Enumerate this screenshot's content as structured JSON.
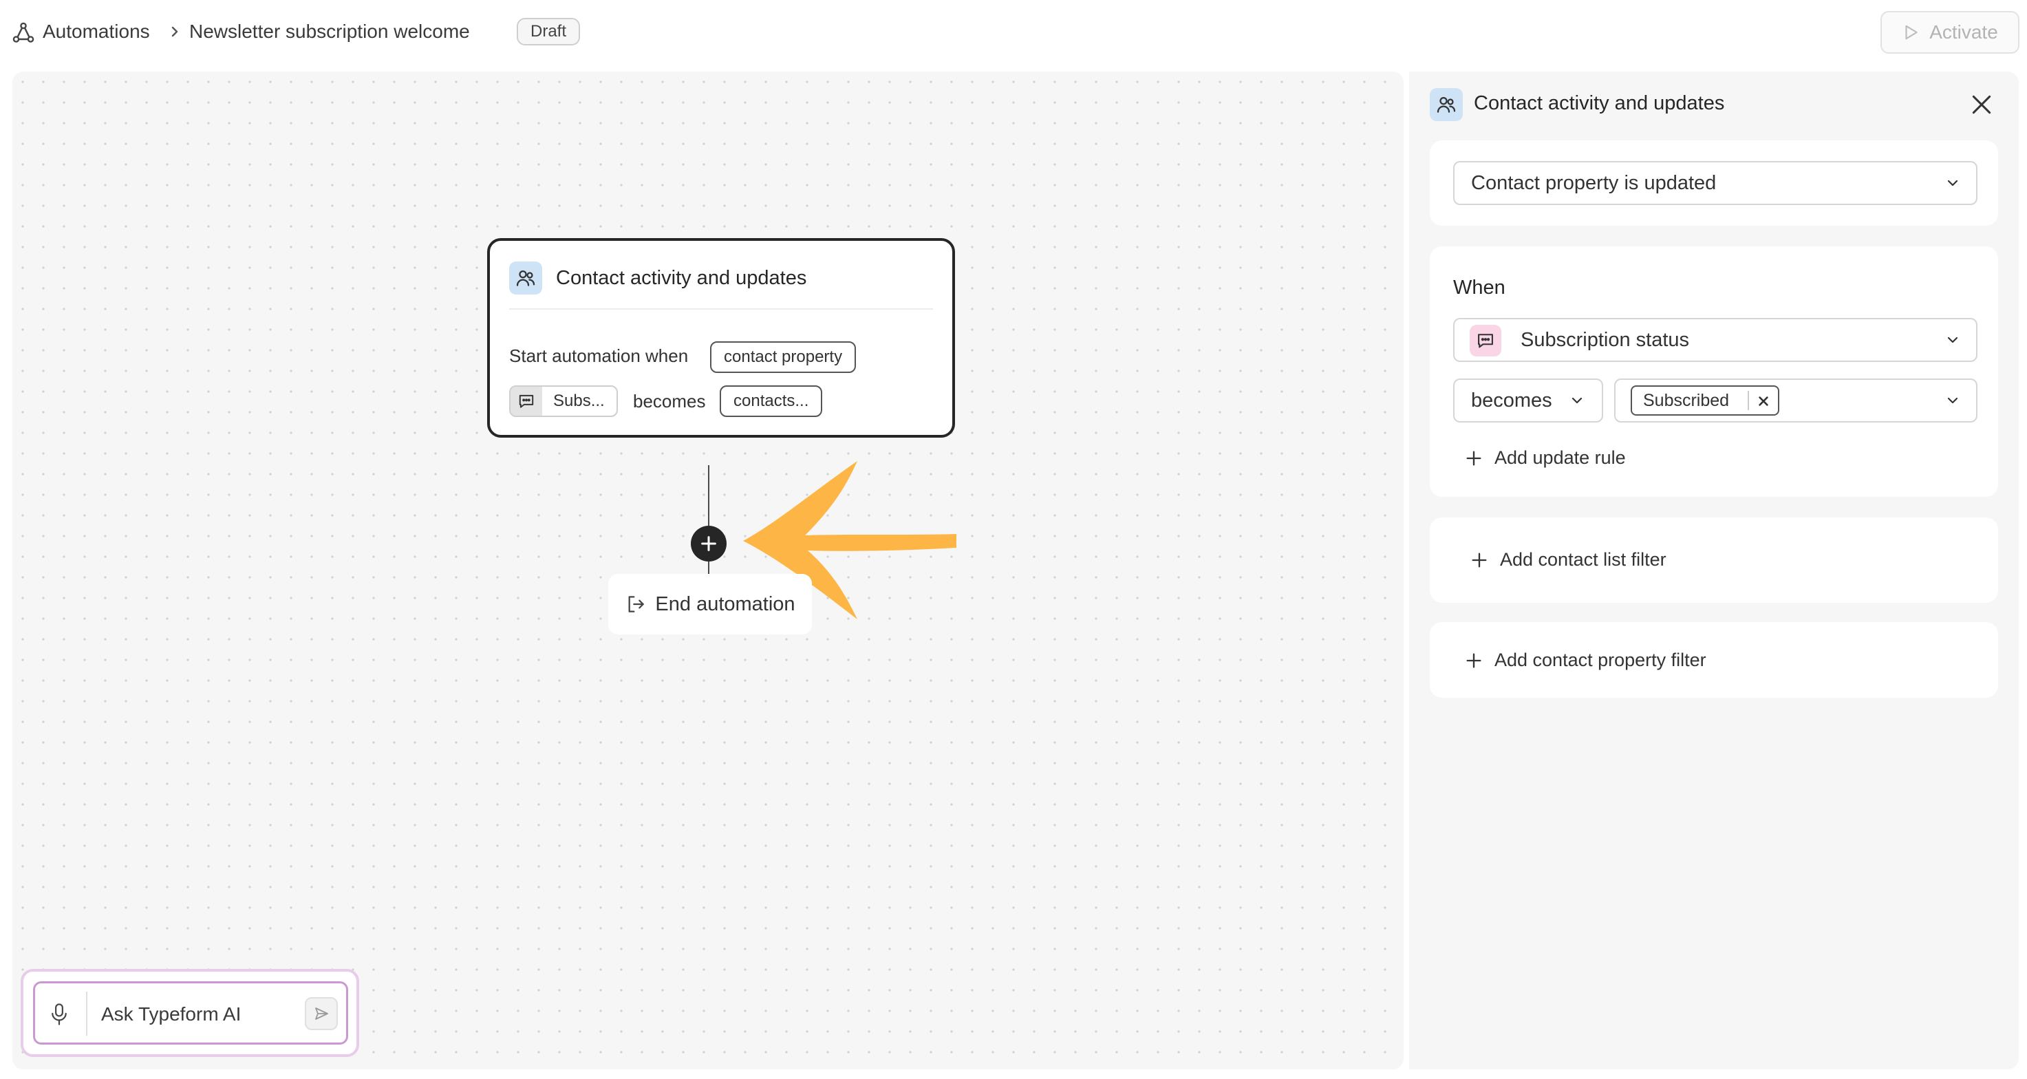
{
  "breadcrumb": {
    "root": "Automations",
    "current": "Newsletter subscription welcome",
    "status": "Draft"
  },
  "toolbar": {
    "activate_label": "Activate"
  },
  "canvas": {
    "trigger_card": {
      "title": "Contact activity and updates",
      "start_text": "Start automation when",
      "property_chip": "contact property",
      "field_chip": "Subs...",
      "becomes_text": "becomes",
      "value_chip": "contacts..."
    },
    "end_node": {
      "label": "End automation"
    },
    "ai_assistant": {
      "placeholder": "Ask Typeform AI"
    }
  },
  "panel": {
    "title": "Contact activity and updates",
    "trigger_type": "Contact property is updated",
    "when": {
      "label": "When",
      "property": "Subscription status",
      "operator": "becomes",
      "value_tag": "Subscribed",
      "add_rule": "Add update rule"
    },
    "add_list_filter": "Add contact list filter",
    "add_property_filter": "Add contact property filter"
  },
  "colors": {
    "accent_arrow": "#FDB645",
    "card_border": "#262626",
    "contact_icon_bg": "#CFE3F7",
    "property_icon_bg": "#F9D5E5",
    "ai_border": "#C99AD0"
  },
  "icons": [
    "automation-icon",
    "chevron-right-icon",
    "play-icon",
    "contacts-icon",
    "chat-icon",
    "plus-icon",
    "exit-icon",
    "mic-icon",
    "send-icon",
    "close-icon",
    "chevron-down-icon"
  ]
}
